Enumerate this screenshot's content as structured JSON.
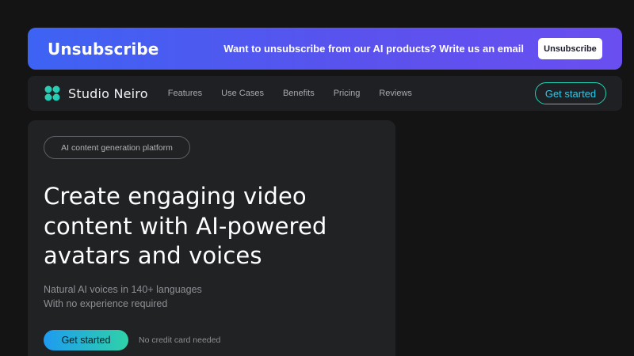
{
  "banner": {
    "title": "Unsubscribe",
    "text": "Want to unsubscribe from our AI products? Write us an email",
    "button_label": "Unsubscribe"
  },
  "nav": {
    "logo_icon": "flower-logo-icon",
    "brand": "Studio Neiro",
    "links": [
      "Features",
      "Use Cases",
      "Benefits",
      "Pricing",
      "Reviews"
    ],
    "cta_label": "Get started"
  },
  "hero": {
    "pill": "AI content generation platform",
    "headline": [
      "Create engaging video",
      "content with AI-powered",
      "avatars and voices"
    ],
    "sub": [
      "Natural AI voices in 140+ languages",
      "With no experience required"
    ],
    "cta_label": "Get started",
    "note": "No credit card needed"
  },
  "colors": {
    "background": "#141414",
    "banner_gradient_start": "#3d63f3",
    "banner_gradient_end": "#6a4ef0",
    "accent_teal": "#1fd3b4",
    "accent_blue": "#1e9bf0"
  }
}
